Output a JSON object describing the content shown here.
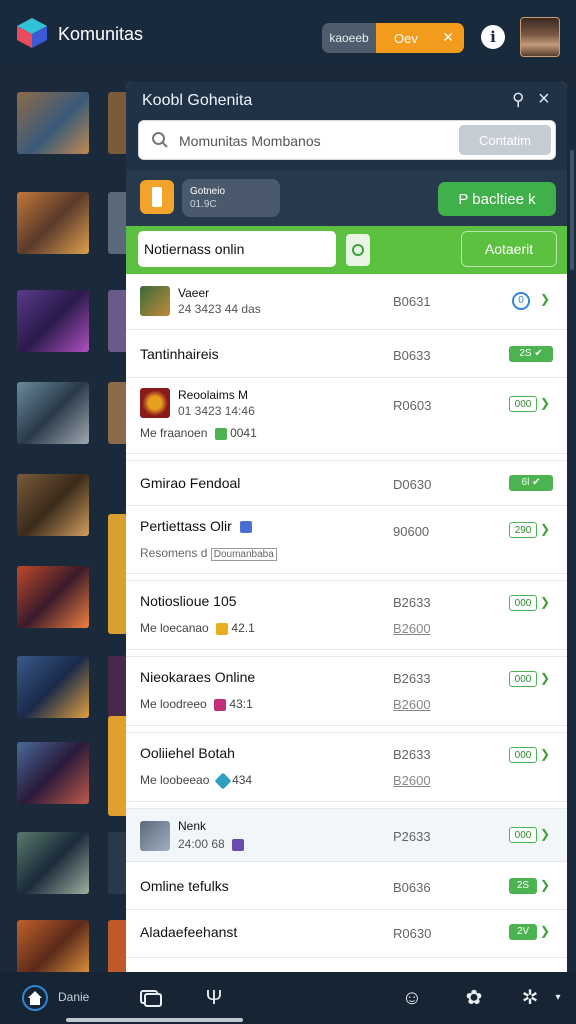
{
  "app": {
    "title": "Komunitas",
    "toggle_left": "kaoeeb",
    "toggle_right": "Oev",
    "toggle_accent": "#f39b1d"
  },
  "panel": {
    "title": "Koobl Gohenita",
    "search_placeholder": "Momunitas Mombanos",
    "search_button": "Contatim",
    "mini_chip_title": "Gotneio",
    "mini_chip_sub": "01.9C",
    "primary_button": "P bacltiee k",
    "notif_input": "Notiernass onlin",
    "notif_button": "Aotaerit"
  },
  "rows": [
    {
      "name": "Vaeer",
      "meta": "24 3423 44 das",
      "code": "B0631",
      "badge": "0",
      "has_icon": true
    },
    {
      "name": "Tantinhaireis",
      "code": "B0633",
      "badge": "2S"
    },
    {
      "name": "Reoolaims M",
      "meta": "01 3423 14:46",
      "sub": "Me fraanoen",
      "sub_num": "0041",
      "code": "R0603",
      "badge": "000",
      "has_icon": true
    },
    {
      "name": "Gmirao Fendoal",
      "code": "D0630",
      "badge": "6l"
    },
    {
      "name": "Pertiettass Olir",
      "sub": "Resomens d",
      "sub_link": "Doumanbaba",
      "code": "90600",
      "badge": "290"
    },
    {
      "name": "Notioslioue 105",
      "sub": "Me loecanao",
      "sub_num": "42.1",
      "code": "B2633",
      "code2": "B2600",
      "badge": "000"
    },
    {
      "name": "Nieokaraes Online",
      "sub": "Me loodreeo",
      "sub_num": "43:1",
      "code": "B2633",
      "code2": "B2600",
      "badge": "000"
    },
    {
      "name": "Ooliiehel Botah",
      "sub": "Me loobeeao",
      "sub_num": "434",
      "code": "B2633",
      "code2": "B2600",
      "badge": "000"
    },
    {
      "name": "Nenk",
      "meta": "24:00 68",
      "code": "P2633",
      "badge": "000",
      "has_icon": true
    },
    {
      "name": "Omline tefulks",
      "code": "B0636",
      "badge": "2S"
    },
    {
      "name": "Aladaefeehanst",
      "code": "R0630",
      "badge": "2V"
    }
  ],
  "bottom_nav": {
    "home_label": "Danie",
    "icons": [
      "home-icon",
      "chat-icon",
      "trophy-icon",
      "smile-icon",
      "gear-icon",
      "settings-icon"
    ]
  }
}
